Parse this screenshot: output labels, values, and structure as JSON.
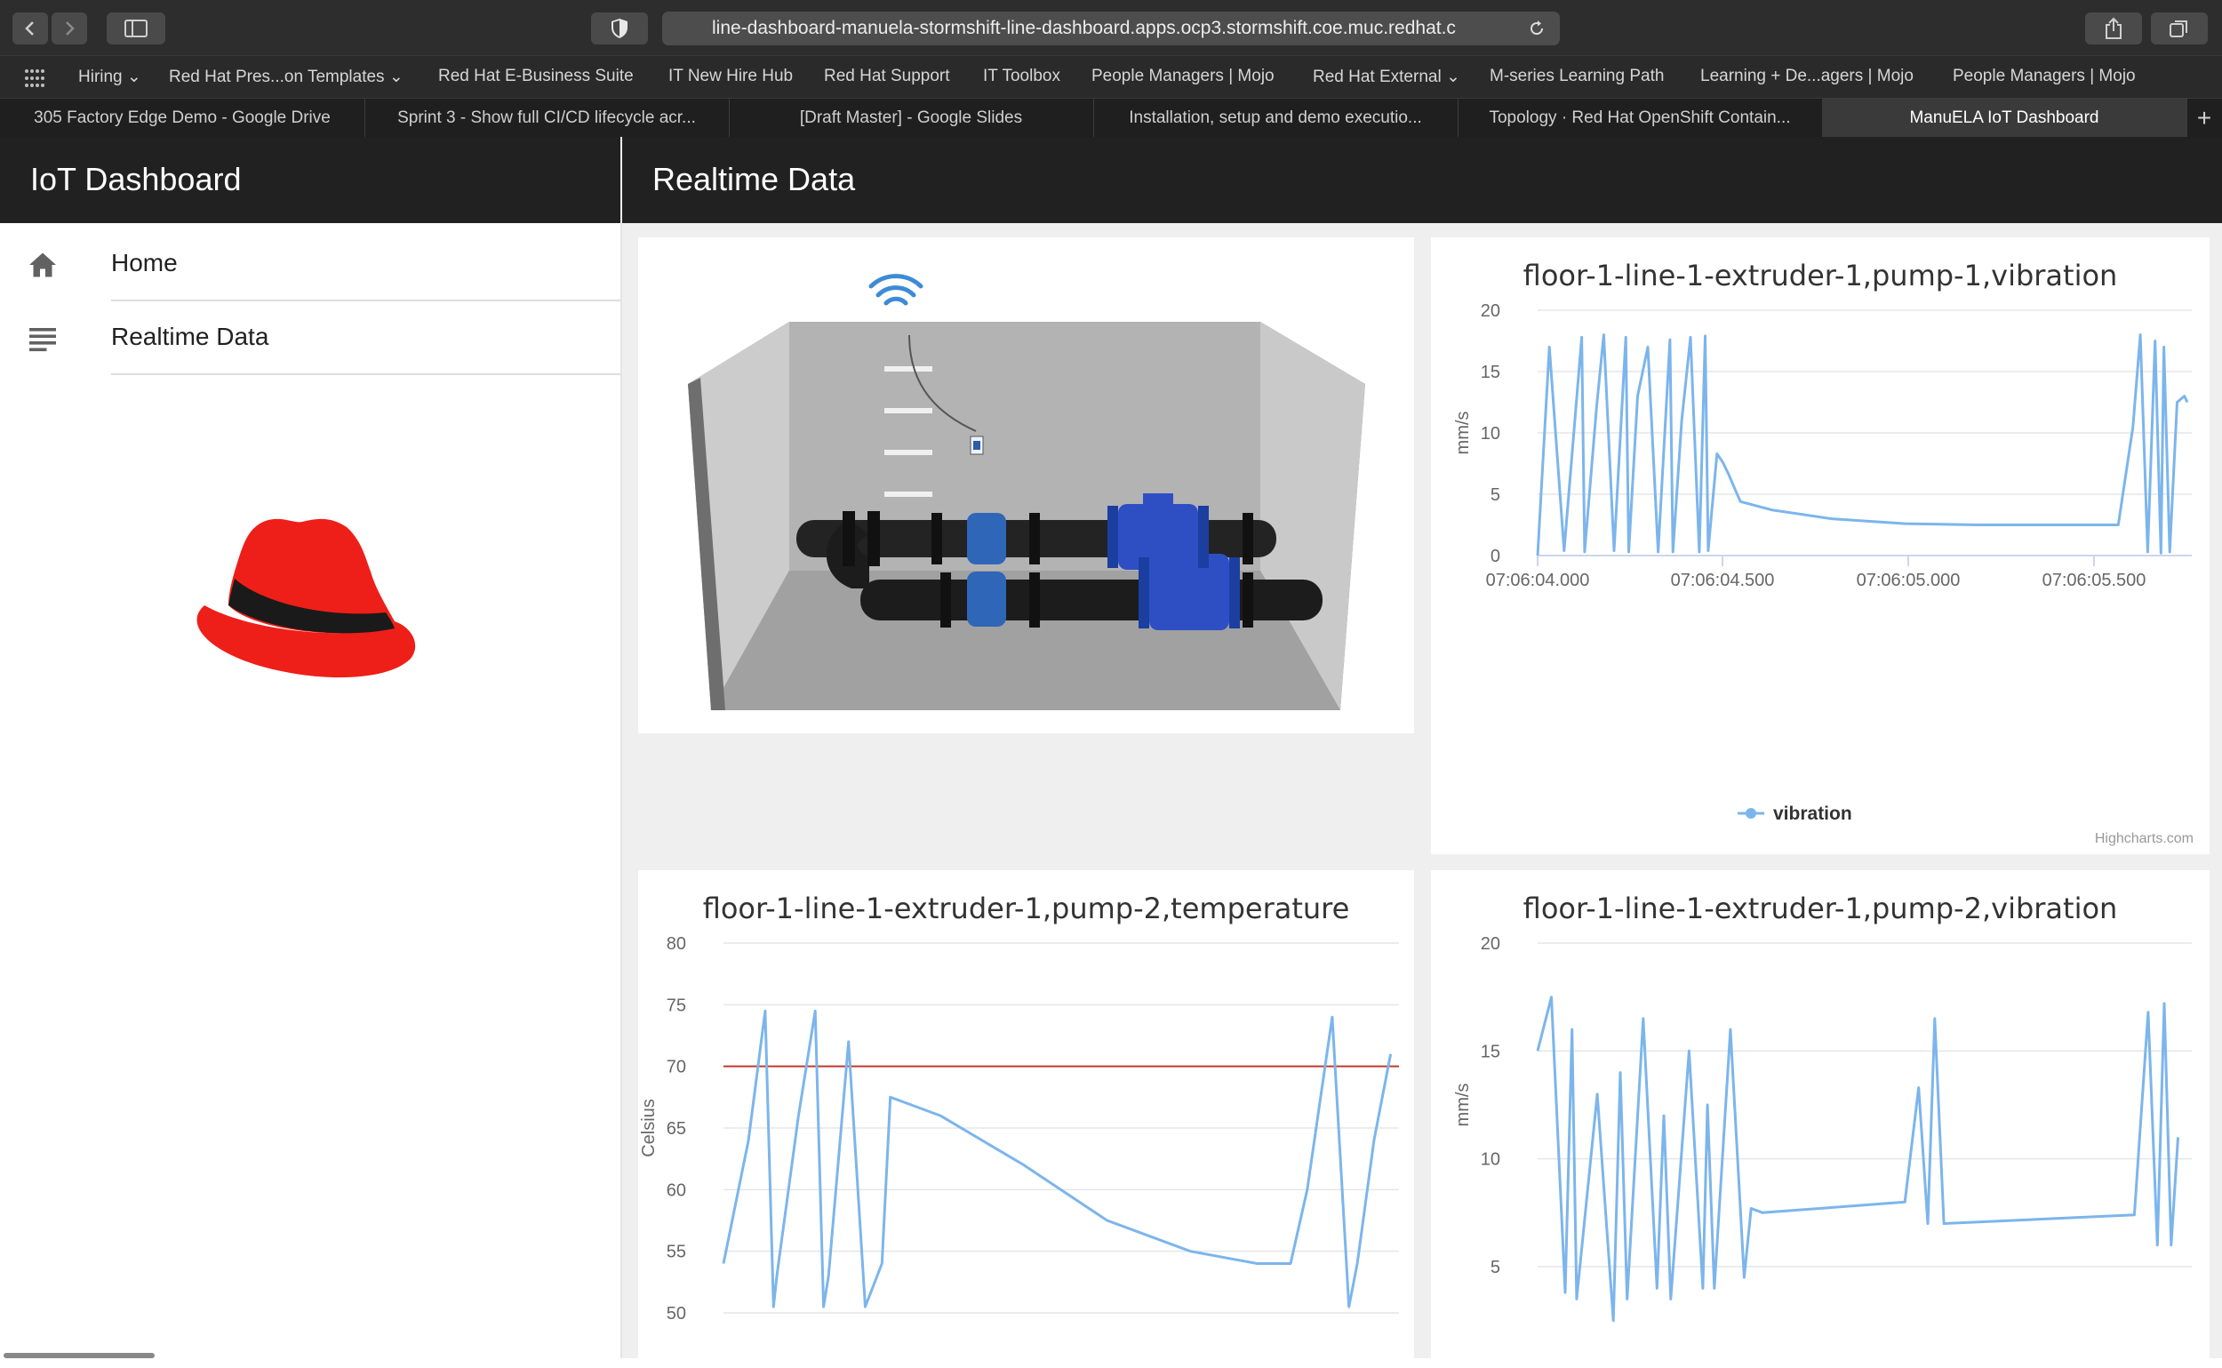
{
  "browser": {
    "url": "line-dashboard-manuela-stormshift-line-dashboard.apps.ocp3.stormshift.coe.muc.redhat.c",
    "bookmarks": [
      "Hiring",
      "Red Hat Pres...on Templates",
      "Red Hat E-Business Suite",
      "IT New Hire Hub",
      "Red Hat Support",
      "IT Toolbox",
      "People Managers | Mojo",
      "Red Hat External",
      "M-series Learning Path",
      "Learning + De...agers | Mojo",
      "People Managers | Mojo"
    ],
    "tabs": [
      "305 Factory Edge Demo - Google Drive",
      "Sprint 3 - Show full CI/CD lifecycle acr...",
      "[Draft Master] - Google Slides",
      "Installation, setup and demo executio...",
      "Topology · Red Hat OpenShift Contain...",
      "ManuELA IoT Dashboard"
    ],
    "new_tab": "+"
  },
  "app": {
    "brand": "IoT Dashboard",
    "page_title": "Realtime Data",
    "nav": [
      {
        "label": "Home",
        "icon": "home-icon"
      },
      {
        "label": "Realtime Data",
        "icon": "list-icon"
      }
    ],
    "logo": "red-hat-fedora-logo",
    "credit": "Highcharts.com",
    "series_color": "#7cb5ec",
    "threshold_color": "#c0392b"
  },
  "chart_data": [
    {
      "type": "line",
      "title": "floor-1-line-1-extruder-1,pump-1,vibration",
      "ylabel": "mm/s",
      "ylim": [
        0,
        20
      ],
      "yticks": [
        "0",
        "5",
        "10",
        "15",
        "20"
      ],
      "xticks": [
        "07:06:04.000",
        "07:06:04.500",
        "07:06:05.000",
        "07:06:05.500"
      ],
      "legend": "vibration",
      "series": [
        {
          "name": "vibration",
          "x": [
            0,
            0.8,
            1.8,
            3.0,
            3.2,
            4.0,
            4.5,
            5.2,
            6.0,
            6.2,
            6.8,
            7.5,
            8.2,
            9.0,
            9.2,
            9.8,
            10.4,
            11.0,
            11.4,
            11.6,
            12.2,
            12.6,
            13.0,
            13.5,
            13.8,
            16.0,
            20.0,
            25.0,
            30.0,
            35.0,
            39.5,
            40.5,
            41.0,
            41.5,
            42.0,
            42.4,
            42.6,
            43.0,
            43.5,
            44.0,
            44.2
          ],
          "values": [
            0,
            17.0,
            0.4,
            17.8,
            0.3,
            12.0,
            18.0,
            0.4,
            17.8,
            0.3,
            13.0,
            17.0,
            0.3,
            17.6,
            0.3,
            11.0,
            17.8,
            0.3,
            17.9,
            0.4,
            8.3,
            7.6,
            6.6,
            5.2,
            4.4,
            3.7,
            3.0,
            2.6,
            2.5,
            2.5,
            2.5,
            10.5,
            18.0,
            0.3,
            17.5,
            0.2,
            17.0,
            0.3,
            12.5,
            13.0,
            12.5
          ]
        }
      ]
    },
    {
      "type": "line",
      "title": "floor-1-line-1-extruder-1,pump-2,temperature",
      "ylabel": "Celsius",
      "ylim": [
        50,
        80
      ],
      "yticks": [
        "50",
        "55",
        "60",
        "65",
        "70",
        "75",
        "80"
      ],
      "xticks": [],
      "threshold": 70,
      "series": [
        {
          "name": "temperature",
          "x": [
            0,
            1.5,
            2.5,
            3.0,
            3.2,
            4.5,
            5.5,
            6.0,
            6.3,
            7.5,
            8.5,
            9.5,
            10.0,
            13.0,
            18.0,
            23.0,
            28.0,
            32.0,
            34.0,
            35.0,
            36.5,
            37.5,
            38.0,
            39.0,
            40.0
          ],
          "values": [
            54,
            64,
            74.5,
            50.5,
            53,
            66,
            74.5,
            50.5,
            53,
            72,
            50.5,
            54,
            67.5,
            66,
            62,
            57.5,
            55,
            54,
            54,
            60,
            74,
            50.5,
            54,
            64,
            71
          ]
        }
      ]
    },
    {
      "type": "line",
      "title": "floor-1-line-1-extruder-1,pump-2,vibration",
      "ylabel": "mm/s",
      "ylim": [
        5,
        20
      ],
      "yticks": [
        "5",
        "10",
        "15",
        "20"
      ],
      "xticks": [],
      "series": [
        {
          "name": "vibration",
          "x": [
            0,
            0.6,
            1.2,
            1.5,
            1.7,
            2.6,
            3.3,
            3.6,
            3.9,
            4.6,
            5.2,
            5.5,
            5.8,
            6.6,
            7.2,
            7.4,
            7.7,
            8.4,
            9.0,
            9.3,
            9.8,
            16.0,
            16.6,
            17.0,
            17.3,
            17.7,
            26.0,
            26.6,
            27.0,
            27.3,
            27.6,
            27.9
          ],
          "values": [
            15,
            17.5,
            3.8,
            16,
            3.5,
            13,
            2.5,
            14,
            3.5,
            16.5,
            4,
            12,
            3.5,
            15,
            4,
            12.5,
            4,
            16,
            4.5,
            7.7,
            7.5,
            8,
            13.3,
            7,
            16.5,
            7,
            7.4,
            16.8,
            6,
            17.2,
            6,
            11
          ]
        }
      ]
    }
  ]
}
